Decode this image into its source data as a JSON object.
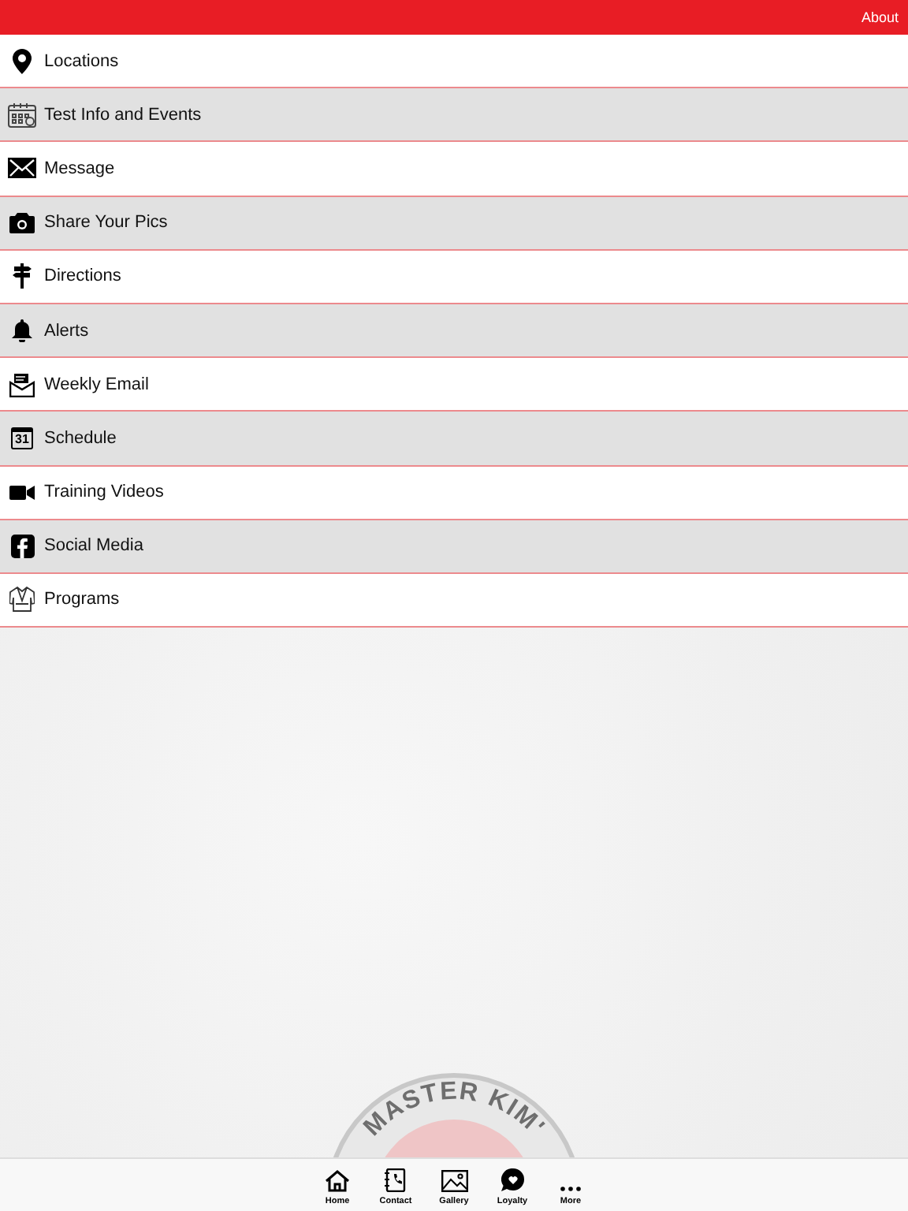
{
  "top_bar": {
    "link": "About"
  },
  "menu": [
    {
      "label": "Locations"
    },
    {
      "label": "Test Info and Events"
    },
    {
      "label": "Message"
    },
    {
      "label": "Share Your Pics"
    },
    {
      "label": "Directions"
    },
    {
      "label": "Alerts"
    },
    {
      "label": "Weekly Email"
    },
    {
      "label": "Schedule"
    },
    {
      "label": "Training Videos"
    },
    {
      "label": "Social Media"
    },
    {
      "label": "Programs"
    }
  ],
  "logo_text": "MASTER KIM'",
  "calendar_day": "31",
  "tab_bar": [
    {
      "label": "Home"
    },
    {
      "label": "Contact"
    },
    {
      "label": "Gallery"
    },
    {
      "label": "Loyalty"
    },
    {
      "label": "More"
    }
  ]
}
